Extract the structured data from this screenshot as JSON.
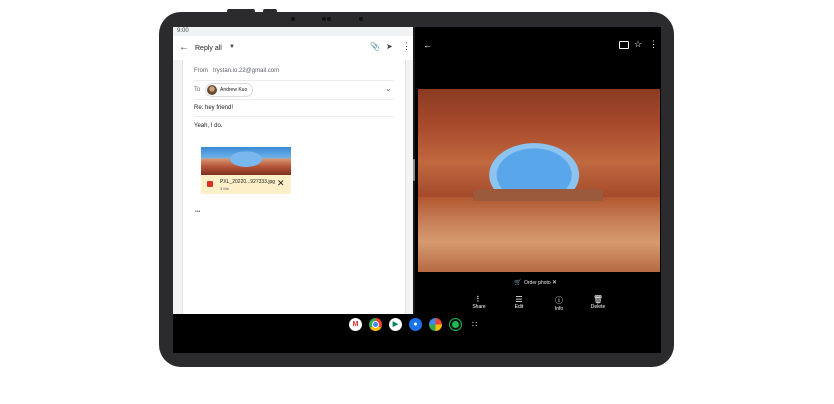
{
  "status": {
    "time": "9:00"
  },
  "gmail": {
    "toolbar": {
      "title": "Reply all",
      "back_icon": "arrow-back-icon",
      "attach_icon": "attachment-icon",
      "send_icon": "send-icon",
      "more_icon": "more-vert-icon"
    },
    "from": {
      "label": "From",
      "value": "trystan.io.22@gmail.com"
    },
    "to": {
      "label": "To",
      "chip": "Andrew Kuo"
    },
    "subject": "Re: hey friend!",
    "body": "Yeah, I do.",
    "attachment": {
      "filename": "PXL_20220...927333.jpg",
      "size": "3 Mb"
    },
    "ellipsis": "•••"
  },
  "photos": {
    "toolbar": {
      "back_icon": "arrow-back-icon",
      "cast_icon": "cast-icon",
      "star_icon": "star-icon",
      "more_icon": "more-vert-icon"
    },
    "order_photo": "Order photo",
    "actions": [
      {
        "label": "Share",
        "icon": "share-icon"
      },
      {
        "label": "Edit",
        "icon": "edit-sliders-icon"
      },
      {
        "label": "Info",
        "icon": "info-icon"
      },
      {
        "label": "Delete",
        "icon": "delete-icon"
      }
    ]
  },
  "shelf": {
    "apps": [
      {
        "name": "Gmail",
        "color": "#ffffff"
      },
      {
        "name": "Chrome",
        "color": "#e8453c"
      },
      {
        "name": "Play Store",
        "color": "#ffffff"
      },
      {
        "name": "Camera",
        "color": "#1a73e8"
      },
      {
        "name": "Photos",
        "color": "#ffffff"
      },
      {
        "name": "Spotify",
        "color": "#1db954"
      },
      {
        "name": "App launcher",
        "color": "#000000"
      }
    ]
  }
}
